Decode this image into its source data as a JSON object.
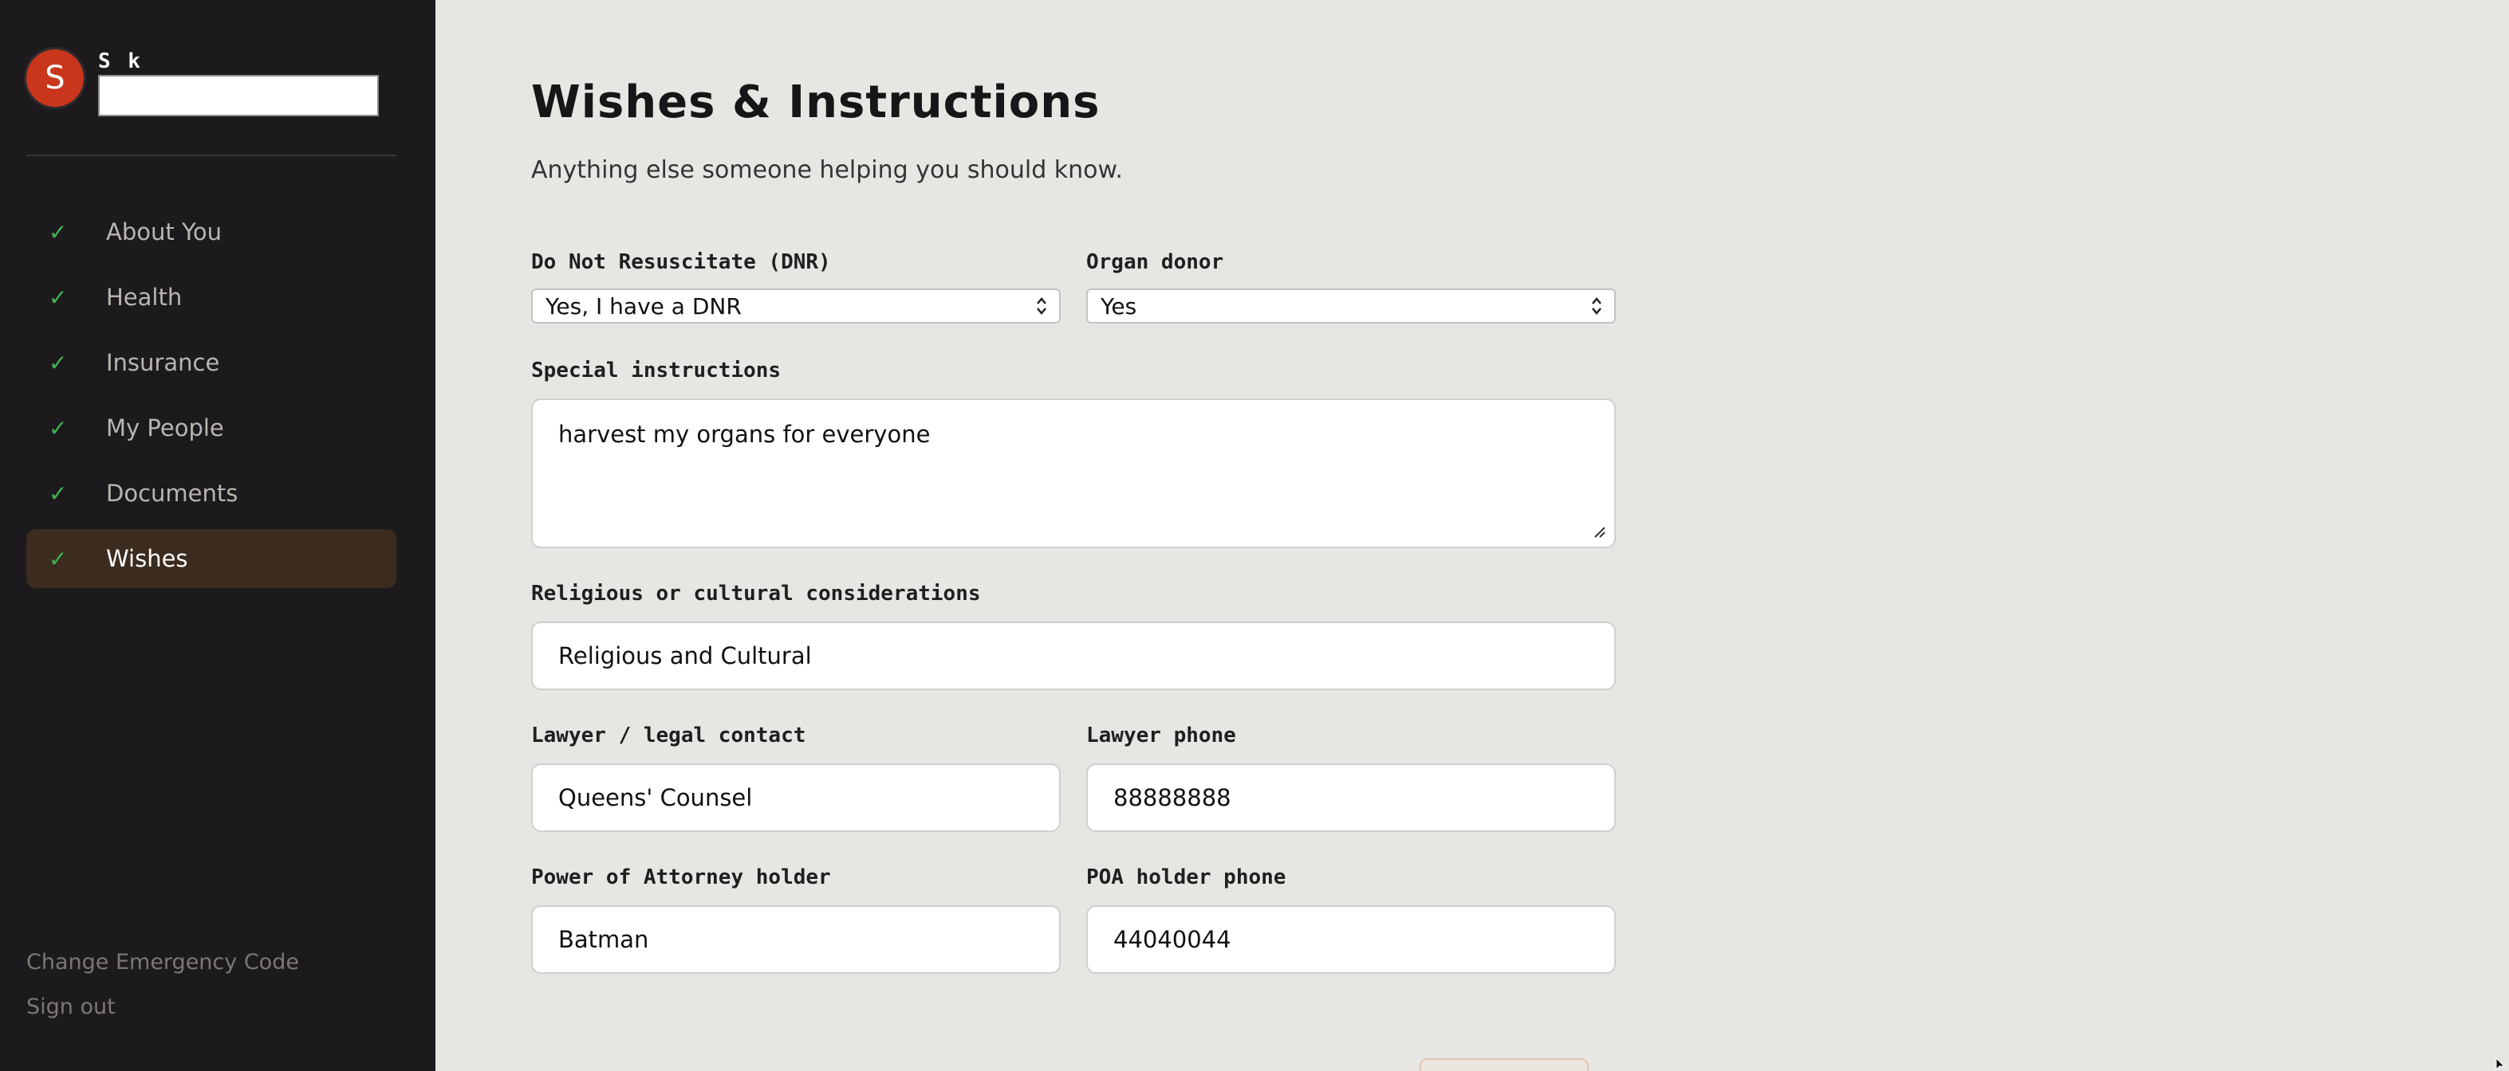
{
  "user": {
    "initial": "S",
    "name": "S k",
    "name_input_value": ""
  },
  "sidebar": {
    "items": [
      {
        "label": "About You",
        "check": "✓"
      },
      {
        "label": "Health",
        "check": "✓"
      },
      {
        "label": "Insurance",
        "check": "✓"
      },
      {
        "label": "My People",
        "check": "✓"
      },
      {
        "label": "Documents",
        "check": "✓"
      },
      {
        "label": "Wishes",
        "check": "✓"
      }
    ],
    "active": "Wishes",
    "footer": {
      "change_code": "Change Emergency Code",
      "sign_out": "Sign out"
    }
  },
  "page": {
    "title": "Wishes & Instructions",
    "subtitle": "Anything else someone helping you should know."
  },
  "form": {
    "dnr": {
      "label": "Do Not Resuscitate (DNR)",
      "value": "Yes, I have a DNR"
    },
    "organ_donor": {
      "label": "Organ donor",
      "value": "Yes"
    },
    "special_instructions": {
      "label": "Special instructions",
      "value": "harvest my organs for everyone"
    },
    "religious": {
      "label": "Religious or cultural considerations",
      "value": "Religious and Cultural"
    },
    "lawyer": {
      "label": "Lawyer / legal contact",
      "value": "Queens' Counsel"
    },
    "lawyer_phone": {
      "label": "Lawyer phone",
      "value": "88888888"
    },
    "poa_holder": {
      "label": "Power of Attorney holder",
      "value": "Batman"
    },
    "poa_phone": {
      "label": "POA holder phone",
      "value": "44040044"
    }
  },
  "colors": {
    "sidebar_bg": "#1d1a1e",
    "main_bg": "#e7e6e3",
    "avatar": "#c9361b",
    "check": "#3fb454",
    "active_item_bg": "#3b2c1f"
  },
  "icons": {
    "check": "check-icon",
    "select_arrows": "select-arrows-icon",
    "resize": "resize-grip-icon",
    "cursor": "mouse-cursor-icon"
  }
}
